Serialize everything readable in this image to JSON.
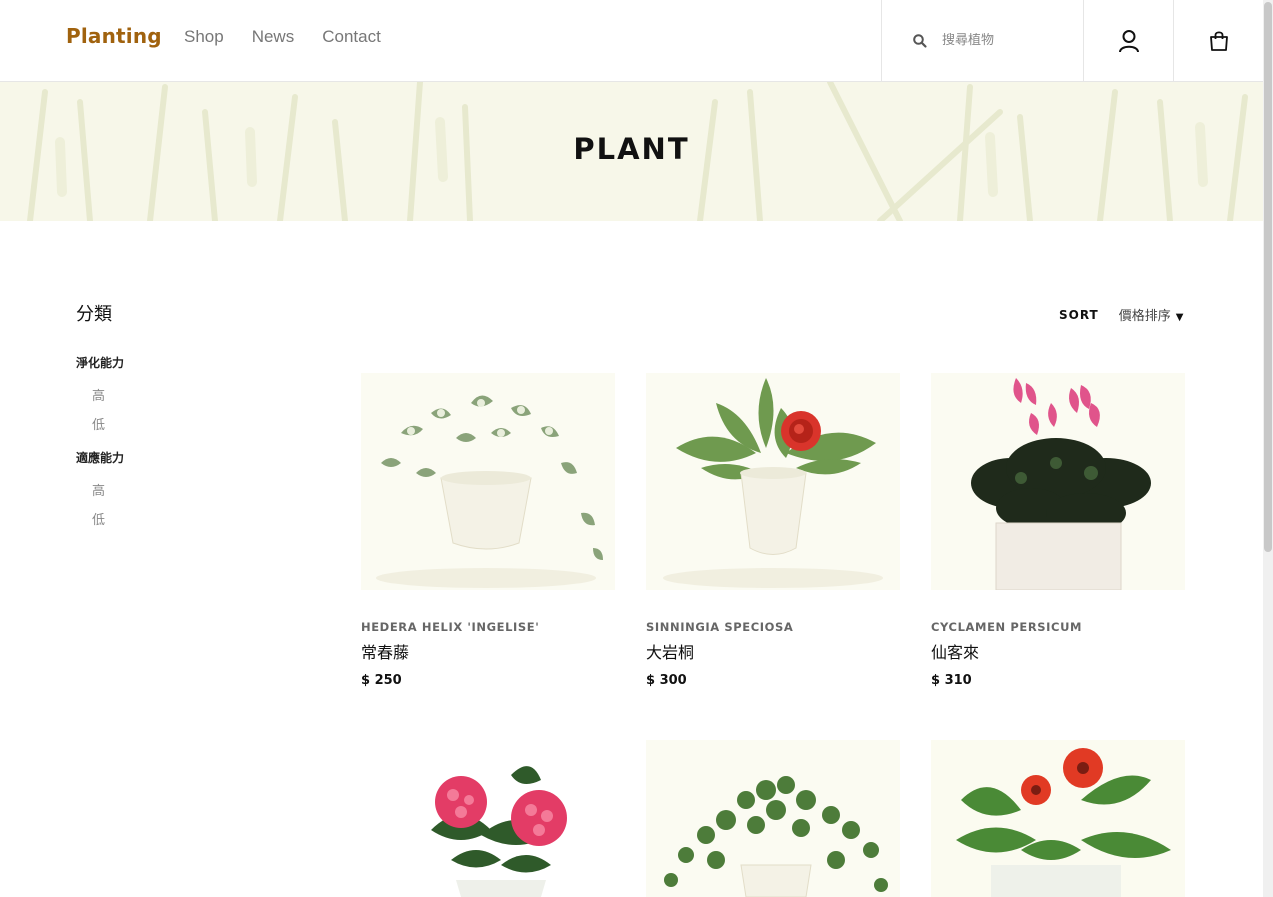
{
  "brand": {
    "logo": "Planting",
    "accent": "#a0620e"
  },
  "nav": {
    "items": [
      "Shop",
      "News",
      "Contact"
    ]
  },
  "search": {
    "placeholder": "搜尋植物",
    "icon": "search-icon"
  },
  "header_icons": {
    "user": "user-icon",
    "cart": "shopping-bag-icon"
  },
  "hero": {
    "title": "PLANT"
  },
  "sidebar": {
    "title": "分類",
    "groups": [
      {
        "title": "淨化能力",
        "options": [
          "高",
          "低"
        ]
      },
      {
        "title": "適應能力",
        "options": [
          "高",
          "低"
        ]
      }
    ]
  },
  "sort": {
    "label": "SORT",
    "value": "價格排序"
  },
  "products": [
    {
      "latin": "HEDERA HELIX 'INGELISE'",
      "name": "常春藤",
      "price": "$ 250"
    },
    {
      "latin": "SINNINGIA SPECIOSA",
      "name": "大岩桐",
      "price": "$ 300"
    },
    {
      "latin": "CYCLAMEN PERSICUM",
      "name": "仙客來",
      "price": "$ 310"
    },
    {
      "latin": "",
      "name": "",
      "price": ""
    },
    {
      "latin": "",
      "name": "",
      "price": ""
    },
    {
      "latin": "",
      "name": "",
      "price": ""
    }
  ]
}
